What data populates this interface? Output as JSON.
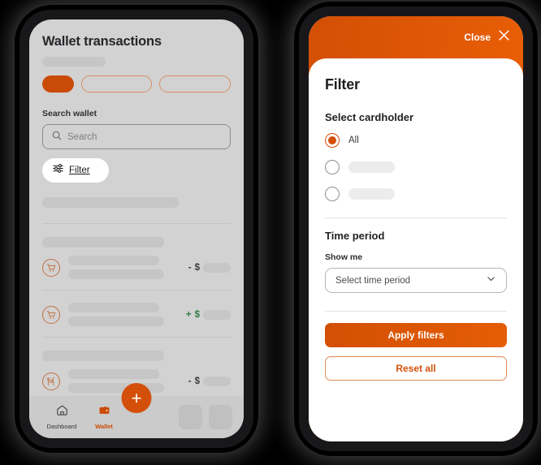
{
  "theme": {
    "accent": "#d4500a",
    "accent_dark": "#c94b06",
    "accent_light": "#ef6307",
    "positive": "#2f7d46",
    "negative": "#3d3d3d",
    "screen_bg_left": "#d2d2d2",
    "screen_bg_right": "#ffffff",
    "frame": "#18181a"
  },
  "left_phone": {
    "page_title": "Wallet transactions",
    "search": {
      "label": "Search wallet",
      "placeholder": "Search",
      "value": "",
      "icon": "search-icon"
    },
    "filter_button": {
      "label": "Filter",
      "icon": "sliders-icon"
    },
    "chips": [
      {
        "state": "selected",
        "label": ""
      },
      {
        "state": "default",
        "label": ""
      },
      {
        "state": "default",
        "label": ""
      }
    ],
    "transactions": [
      {
        "icon": "shopping-cart-icon",
        "merchant": "",
        "detail": "",
        "sign": "-",
        "currency": "$",
        "amount": "",
        "direction": "negative"
      },
      {
        "icon": "shopping-cart-icon",
        "merchant": "",
        "detail": "",
        "sign": "+",
        "currency": "$",
        "amount": "",
        "direction": "positive"
      },
      {
        "icon": "restaurant-icon",
        "merchant": "",
        "detail": "",
        "sign": "-",
        "currency": "$",
        "amount": "",
        "direction": "negative"
      }
    ],
    "tabbar": {
      "items": [
        {
          "label": "Dashboard",
          "icon": "home-icon",
          "active": false
        },
        {
          "label": "Wallet",
          "icon": "wallet-icon",
          "active": true
        }
      ],
      "fab": {
        "label": "+",
        "icon": "plus-icon"
      }
    }
  },
  "right_phone": {
    "header": {
      "close_label": "Close",
      "close_icon": "close-icon"
    },
    "sheet_title": "Filter",
    "cardholder": {
      "section_title": "Select cardholder",
      "options": [
        {
          "label": "All",
          "selected": true
        },
        {
          "label": "",
          "selected": false
        },
        {
          "label": "",
          "selected": false
        }
      ]
    },
    "time_period": {
      "section_title": "Time period",
      "field_label": "Show me",
      "select_value": "Select time period",
      "chevron_icon": "chevron-down-icon"
    },
    "actions": {
      "apply_label": "Apply filters",
      "reset_label": "Reset all"
    }
  }
}
